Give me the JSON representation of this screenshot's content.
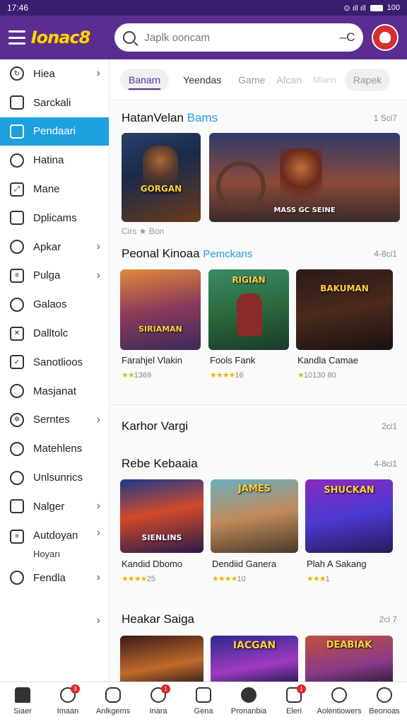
{
  "status": {
    "time": "17:46",
    "icons": "⊙ ıll ıll",
    "battery": "100"
  },
  "header": {
    "logo": "Ionac8",
    "search_placeholder": "Japlk ooncam",
    "voice_icon": "microphone-icon"
  },
  "sidebar": {
    "items": [
      {
        "label": "Hiea",
        "chevron": true
      },
      {
        "label": "Sarckali",
        "chevron": false
      },
      {
        "label": "Pendaari",
        "chevron": false,
        "active": true
      },
      {
        "label": "Hatina",
        "chevron": false
      },
      {
        "label": "Mane",
        "chevron": false
      },
      {
        "label": "Dplicams",
        "chevron": false
      },
      {
        "label": "Apkar",
        "chevron": true
      },
      {
        "label": "Pulga",
        "chevron": true
      },
      {
        "label": "Galaos",
        "chevron": false
      },
      {
        "label": "Dalltolc",
        "chevron": false
      },
      {
        "label": "Sanotlioos",
        "chevron": false
      },
      {
        "label": "Masjanat",
        "chevron": false
      },
      {
        "label": "Serntes",
        "chevron": true
      },
      {
        "label": "Matehlens",
        "chevron": false
      },
      {
        "label": "Unlsunrics",
        "chevron": false
      },
      {
        "label": "Nalger",
        "chevron": true
      },
      {
        "label": "Autdoyan",
        "sub": "Hoyarı",
        "chevron": true
      },
      {
        "label": "Fendla",
        "chevron": true
      }
    ],
    "more_chevron": "›"
  },
  "tabs": [
    {
      "label": "Banarn",
      "active": true
    },
    {
      "label": "Yeendas"
    },
    {
      "label": "Game"
    },
    {
      "label": "Afcan"
    },
    {
      "label": "Mlann"
    },
    {
      "label": "Rapek"
    }
  ],
  "sections": {
    "s1": {
      "title": "HatanVelan",
      "accent": "Bams",
      "count": "1 Sci7",
      "tiles": [
        {
          "art": "GORGAN",
          "caption": "Cirs ★ Bon"
        },
        {
          "art": "MASS GC SEINE",
          "caption": ""
        }
      ]
    },
    "s2": {
      "title": "Peonal Kinoaa",
      "accent": "Pemckans",
      "count": "4-8ci1",
      "tiles": [
        {
          "art": "SIRIAMAN",
          "caption": "Farahjel Vlakin",
          "stars": "★★",
          "rating": "1369"
        },
        {
          "art": "RIGIAN",
          "caption": "Fools Fank",
          "stars": "★★★★",
          "rating": "16"
        },
        {
          "art": "BAKUMAN",
          "caption": "Kandla Camae",
          "stars": "★",
          "rating": "10130 80"
        }
      ]
    },
    "s3": {
      "title": "Karhor Vargi",
      "accent": "",
      "count": "2ci1"
    },
    "s4": {
      "title": "Rebe Kebaaia",
      "accent": "",
      "count": "4-8ci1",
      "tiles": [
        {
          "art": "SIENLINS",
          "caption": "Kandid Dbomo",
          "stars": "★★★★",
          "rating": "25"
        },
        {
          "art": "JAMES",
          "caption": "Dendiid Ganera",
          "stars": "★★★★",
          "rating": "10"
        },
        {
          "art": "SHUCKAN",
          "caption": "Plah A Sakang",
          "stars": "★★★",
          "rating": "1"
        }
      ]
    },
    "s5": {
      "title": "Heakar Saiga",
      "accent": "",
      "count": "2ci 7",
      "tiles": [
        {
          "art": ""
        },
        {
          "art": "IACGAN"
        },
        {
          "art": "DEABIAK"
        }
      ]
    }
  },
  "colors": {
    "header": "#5b2d91",
    "active": "#1e9fde",
    "accent_text": "#1e9fde",
    "logo": "#f7d417",
    "badge": "#e0262b"
  },
  "bottom_nav": [
    {
      "label": "Siaer",
      "icon": "home-icon",
      "badge": ""
    },
    {
      "label": "Imaan",
      "icon": "chat-icon",
      "badge": "3"
    },
    {
      "label": "Anlkgems",
      "icon": "controller-icon",
      "badge": ""
    },
    {
      "label": "Inara",
      "icon": "globe-icon",
      "badge": "1"
    },
    {
      "label": "Gena",
      "icon": "document-icon",
      "badge": ""
    },
    {
      "label": "Pronanbia",
      "icon": "plus-icon",
      "badge": ""
    },
    {
      "label": "Eleri",
      "icon": "message-icon",
      "badge": "1"
    },
    {
      "label": "Aolentiowers",
      "icon": "search-icon",
      "badge": ""
    },
    {
      "label": "Beonoas",
      "icon": "profile-icon",
      "badge": ""
    }
  ]
}
